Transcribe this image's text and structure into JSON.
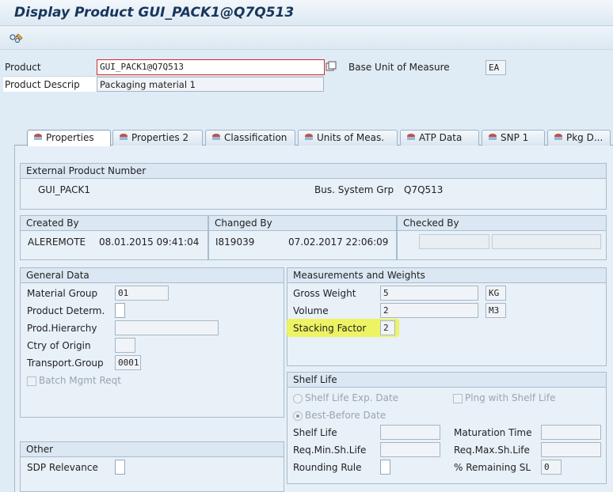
{
  "window": {
    "title": "Display Product GUI_PACK1@Q7Q513"
  },
  "header": {
    "product_label": "Product",
    "product_value": "GUI_PACK1@Q7Q513",
    "descr_label": "Product Descrip",
    "descr_value": "Packaging material 1",
    "uom_label": "Base Unit of Measure",
    "uom_value": "EA"
  },
  "tabs": [
    {
      "label": "Properties"
    },
    {
      "label": "Properties 2"
    },
    {
      "label": "Classification"
    },
    {
      "label": "Units of Meas."
    },
    {
      "label": "ATP Data"
    },
    {
      "label": "SNP 1"
    },
    {
      "label": "Pkg D..."
    }
  ],
  "ext_product": {
    "title": "External Product Number",
    "value": "GUI_PACK1",
    "bus_sys_label": "Bus. System Grp",
    "bus_sys_value": "Q7Q513"
  },
  "created": {
    "title": "Created By",
    "user": "ALEREMOTE",
    "date": "08.01.2015 09:41:04"
  },
  "changed": {
    "title": "Changed By",
    "user": "I819039",
    "date": "07.02.2017 22:06:09"
  },
  "checked": {
    "title": "Checked By"
  },
  "general": {
    "title": "General Data",
    "material_group_label": "Material Group",
    "material_group_value": "01",
    "product_determ_label": "Product Determ.",
    "prod_hierarchy_label": "Prod.Hierarchy",
    "ctry_origin_label": "Ctry of Origin",
    "transport_group_label": "Transport.Group",
    "transport_group_value": "0001",
    "batch_mgmt_label": "Batch Mgmt Reqt"
  },
  "measurements": {
    "title": "Measurements and Weights",
    "gross_weight_label": "Gross Weight",
    "gross_weight_value": "5",
    "gross_weight_unit": "KG",
    "volume_label": "Volume",
    "volume_value": "2",
    "volume_unit": "M3",
    "stacking_label": "Stacking Factor",
    "stacking_value": "2",
    "highlight_color": "#eef34a"
  },
  "shelf_life": {
    "title": "Shelf Life",
    "exp_date_label": "Shelf Life Exp. Date",
    "best_before_label": "Best-Before Date",
    "plng_label": "Plng with Shelf Life",
    "shelf_life_label": "Shelf Life",
    "maturation_label": "Maturation Time",
    "req_min_label": "Req.Min.Sh.Life",
    "req_max_label": "Req.Max.Sh.Life",
    "rounding_label": "Rounding Rule",
    "remaining_label": "% Remaining SL",
    "remaining_value": "0"
  },
  "other": {
    "title": "Other",
    "sdp_label": "SDP Relevance"
  }
}
